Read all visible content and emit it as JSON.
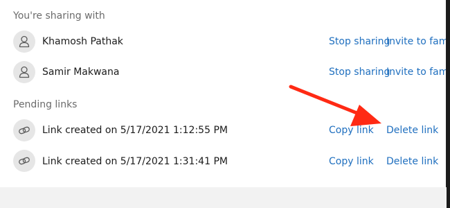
{
  "sharing_section": {
    "header": "You're sharing with"
  },
  "people": [
    {
      "name": "Khamosh Pathak",
      "stop_label": "Stop sharing",
      "invite_label": "Invite to family"
    },
    {
      "name": "Samir Makwana",
      "stop_label": "Stop sharing",
      "invite_label": "Invite to family"
    }
  ],
  "pending_section": {
    "header": "Pending links"
  },
  "links": [
    {
      "text": "Link created on 5/17/2021 1:12:55 PM",
      "copy_label": "Copy link",
      "delete_label": "Delete link"
    },
    {
      "text": "Link created on 5/17/2021 1:31:41 PM",
      "copy_label": "Copy link",
      "delete_label": "Delete link"
    }
  ],
  "icons": {
    "person": "person-icon",
    "link": "link-icon"
  },
  "colors": {
    "link_blue": "#1f6fbf",
    "arrow_red": "#ff2a14",
    "avatar_bg": "#e6e6e6",
    "header_gray": "#6b6b6b"
  }
}
